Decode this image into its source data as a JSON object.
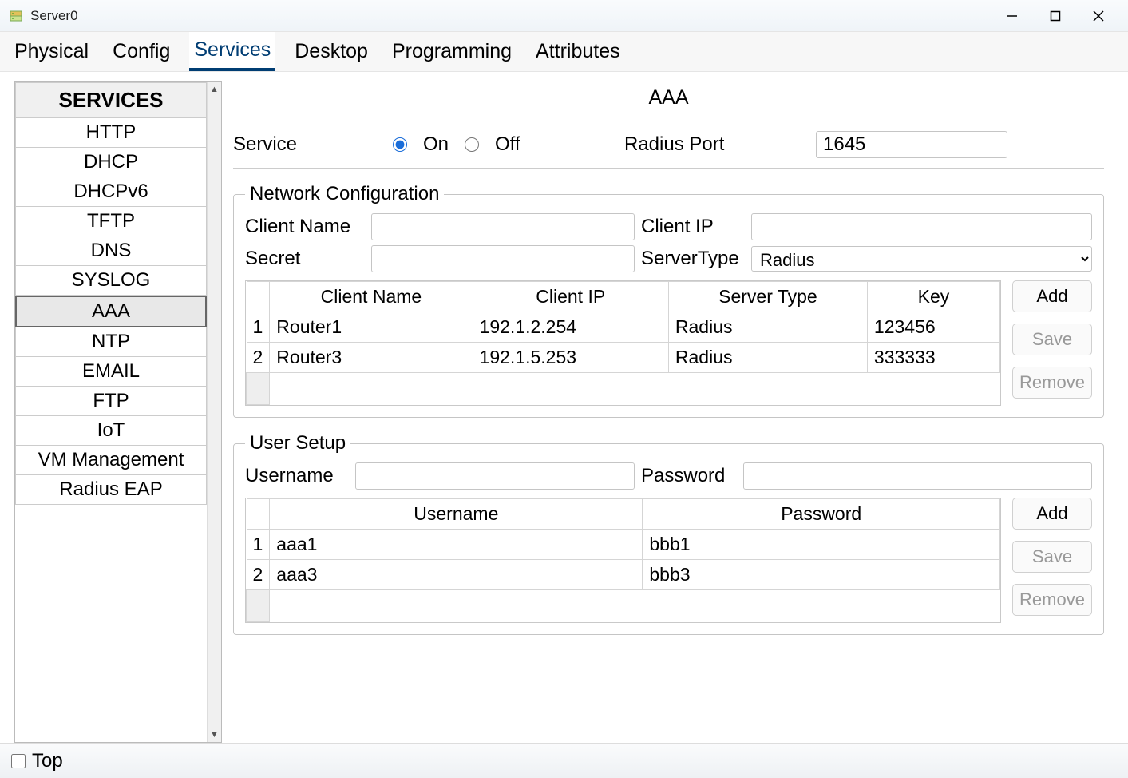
{
  "window": {
    "title": "Server0"
  },
  "tabs": [
    {
      "label": "Physical"
    },
    {
      "label": "Config"
    },
    {
      "label": "Services"
    },
    {
      "label": "Desktop"
    },
    {
      "label": "Programming"
    },
    {
      "label": "Attributes"
    }
  ],
  "sidebar": {
    "header": "SERVICES",
    "items": [
      {
        "label": "HTTP"
      },
      {
        "label": "DHCP"
      },
      {
        "label": "DHCPv6"
      },
      {
        "label": "TFTP"
      },
      {
        "label": "DNS"
      },
      {
        "label": "SYSLOG"
      },
      {
        "label": "AAA"
      },
      {
        "label": "NTP"
      },
      {
        "label": "EMAIL"
      },
      {
        "label": "FTP"
      },
      {
        "label": "IoT"
      },
      {
        "label": "VM Management"
      },
      {
        "label": "Radius EAP"
      }
    ]
  },
  "main": {
    "title": "AAA",
    "service": {
      "label": "Service",
      "on_label": "On",
      "off_label": "Off",
      "port_label": "Radius Port",
      "port_value": "1645"
    },
    "network": {
      "legend": "Network Configuration",
      "client_name_label": "Client Name",
      "client_name_value": "",
      "client_ip_label": "Client IP",
      "client_ip_value": "",
      "secret_label": "Secret",
      "secret_value": "",
      "server_type_label": "ServerType",
      "server_type_value": "Radius",
      "headers": {
        "client_name": "Client Name",
        "client_ip": "Client IP",
        "server_type": "Server Type",
        "key": "Key"
      },
      "rows": [
        {
          "idx": "1",
          "client_name": "Router1",
          "client_ip": "192.1.2.254",
          "server_type": "Radius",
          "key": "123456"
        },
        {
          "idx": "2",
          "client_name": "Router3",
          "client_ip": "192.1.5.253",
          "server_type": "Radius",
          "key": "333333"
        }
      ],
      "buttons": {
        "add": "Add",
        "save": "Save",
        "remove": "Remove"
      }
    },
    "users": {
      "legend": "User Setup",
      "username_label": "Username",
      "username_value": "",
      "password_label": "Password",
      "password_value": "",
      "headers": {
        "username": "Username",
        "password": "Password"
      },
      "rows": [
        {
          "idx": "1",
          "username": "aaa1",
          "password": "bbb1"
        },
        {
          "idx": "2",
          "username": "aaa3",
          "password": "bbb3"
        }
      ],
      "buttons": {
        "add": "Add",
        "save": "Save",
        "remove": "Remove"
      }
    }
  },
  "bottom": {
    "top_label": "Top"
  }
}
